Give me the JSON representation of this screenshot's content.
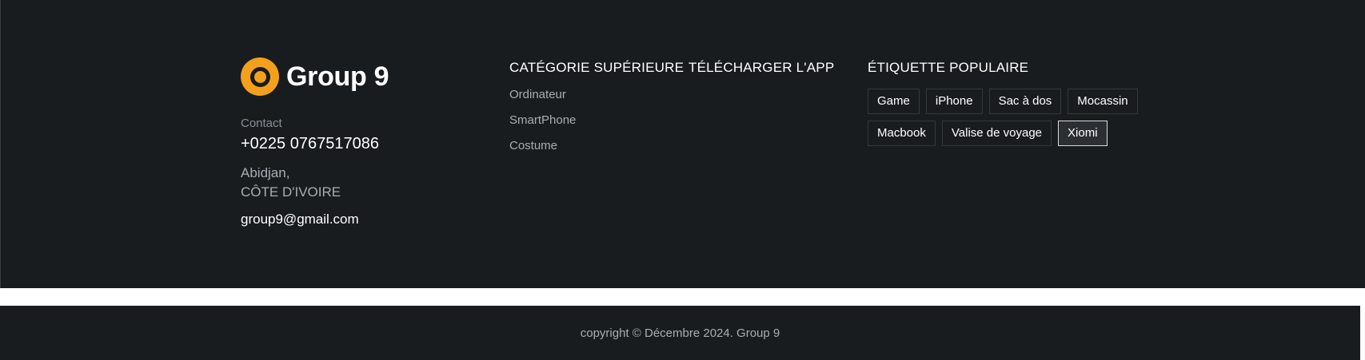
{
  "brand": {
    "name": "Group 9",
    "logo_icon": "ring-logo-icon",
    "logo_color": "#f3a01c"
  },
  "contact": {
    "label": "Contact",
    "phone": "+0225 0767517086",
    "address_line1": "Abidjan,",
    "address_line2": "CÔTE D'IVOIRE",
    "email": "group9@gmail.com"
  },
  "categories": {
    "title": "CATÉGORIE SUPÉRIEURE",
    "items": [
      {
        "label": "Ordinateur"
      },
      {
        "label": "SmartPhone"
      },
      {
        "label": "Costume"
      }
    ]
  },
  "app": {
    "title": "TÉLÉCHARGER L'APP"
  },
  "tags": {
    "title": "ÉTIQUETTE POPULAIRE",
    "items": [
      {
        "label": "Game"
      },
      {
        "label": "iPhone"
      },
      {
        "label": "Sac à dos"
      },
      {
        "label": "Mocassin"
      },
      {
        "label": "Macbook"
      },
      {
        "label": "Valise de voyage"
      },
      {
        "label": "Xiomi"
      }
    ],
    "active_index": 6
  },
  "footer": {
    "copyright": "copyright © Décembre 2024. Group 9"
  },
  "colors": {
    "background": "#191c1f",
    "accent": "#f3a01c",
    "text_primary": "#ffffff",
    "text_muted": "#a9adb3"
  }
}
